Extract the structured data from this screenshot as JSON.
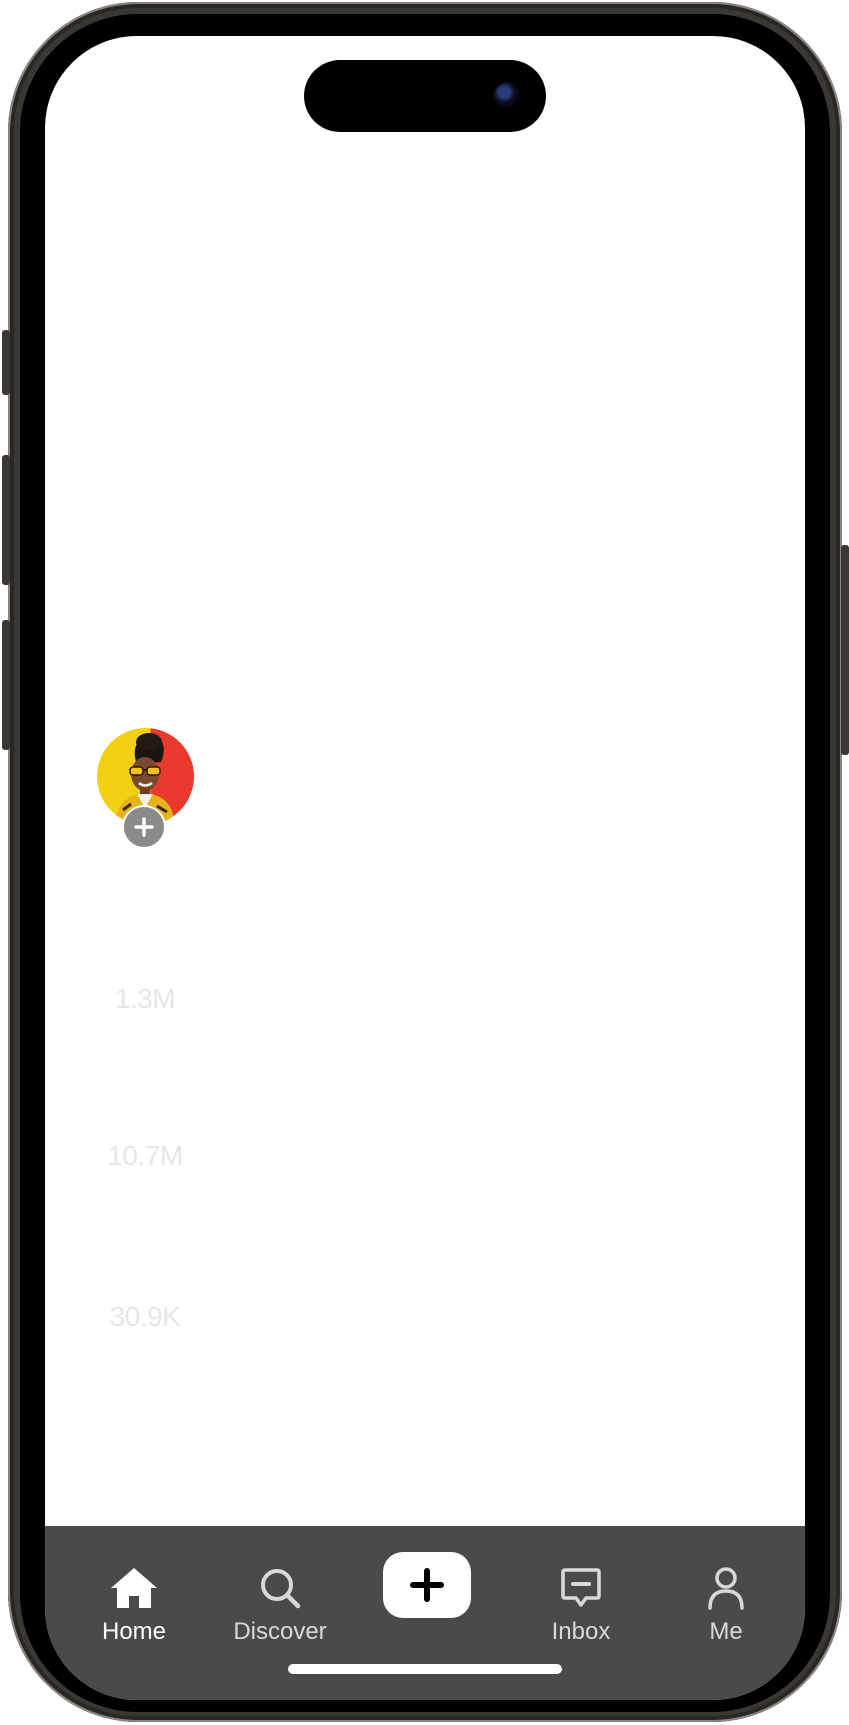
{
  "feed": {
    "creator_avatar": {
      "alt_icon": "creator-avatar"
    },
    "follow_icon": "plus-icon",
    "stats": {
      "likes": "1.3M",
      "comments": "10.7M",
      "shares": "30.9K"
    }
  },
  "tabbar": {
    "background": "#4a4a4a",
    "tabs": [
      {
        "id": "home",
        "label": "Home",
        "icon": "home-icon",
        "active": true
      },
      {
        "id": "discover",
        "label": "Discover",
        "icon": "search-icon",
        "active": false
      },
      {
        "id": "create",
        "label": "",
        "icon": "plus-icon",
        "active": false
      },
      {
        "id": "inbox",
        "label": "Inbox",
        "icon": "inbox-icon",
        "active": false
      },
      {
        "id": "me",
        "label": "Me",
        "icon": "person-icon",
        "active": false
      }
    ]
  }
}
